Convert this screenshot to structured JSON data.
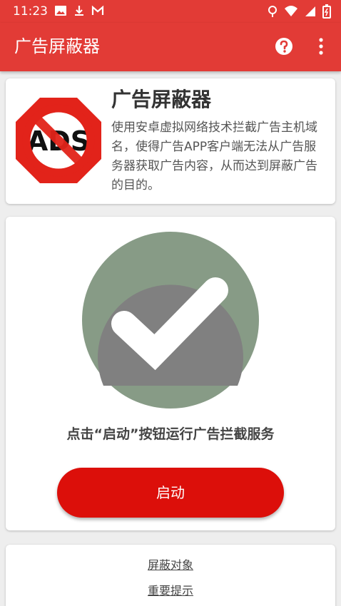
{
  "status_bar": {
    "time": "11:23",
    "left_icons": [
      "image-icon",
      "download-icon",
      "gmail-icon"
    ],
    "right_icons": [
      "location-icon",
      "wifi-icon",
      "signal-icon",
      "battery-icon"
    ]
  },
  "app_bar": {
    "title": "广告屏蔽器",
    "actions": [
      "help-icon",
      "more-vert-icon"
    ]
  },
  "intro_card": {
    "logo_text": "ADS",
    "title": "广告屏蔽器",
    "description": "使用安卓虚拟网络技术拦截广告主机域名，使得广告APP客户端无法从广告服务器获取广告内容，从而达到屏蔽广告的目的。"
  },
  "status_card": {
    "status_icon": "checkmark-icon",
    "hint": "点击“启动”按钮运行广告拦截服务",
    "start_label": "启动"
  },
  "links_card": {
    "blocked_targets": "屏蔽对象",
    "important_notice": "重要提示"
  },
  "colors": {
    "primary": "#e23b36",
    "button": "#dc0f0a",
    "circle_outer": "#879b86",
    "circle_inner": "#808080"
  }
}
